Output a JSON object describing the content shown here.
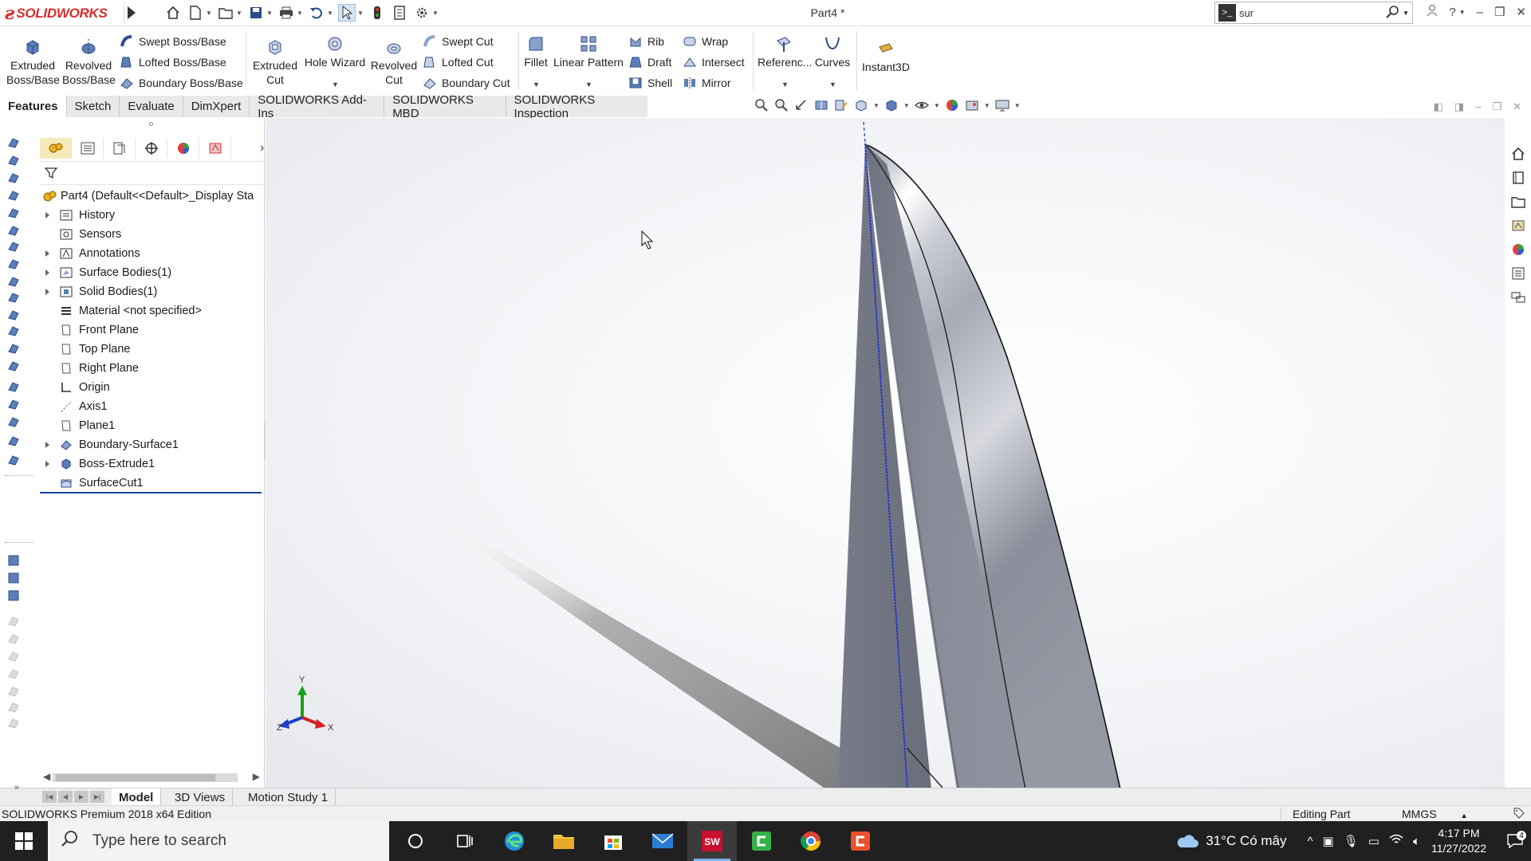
{
  "app": {
    "brand": "SOLIDWORKS",
    "document_title": "Part4 *",
    "search_value": "sur"
  },
  "ribbon": {
    "extruded_boss": [
      "Extruded",
      "Boss/Base"
    ],
    "revolved_boss": [
      "Revolved",
      "Boss/Base"
    ],
    "swept_boss": "Swept Boss/Base",
    "lofted_boss": "Lofted Boss/Base",
    "boundary_boss": "Boundary Boss/Base",
    "extruded_cut": [
      "Extruded",
      "Cut"
    ],
    "hole_wizard": "Hole Wizard",
    "revolved_cut": [
      "Revolved",
      "Cut"
    ],
    "swept_cut": "Swept Cut",
    "lofted_cut": "Lofted Cut",
    "boundary_cut": "Boundary Cut",
    "fillet": "Fillet",
    "linear_pattern": "Linear Pattern",
    "rib": "Rib",
    "draft": "Draft",
    "shell": "Shell",
    "wrap": "Wrap",
    "intersect": "Intersect",
    "mirror": "Mirror",
    "reference": "Referenc...",
    "curves": "Curves",
    "instant3d": "Instant3D"
  },
  "tabs": [
    "Features",
    "Sketch",
    "Evaluate",
    "DimXpert",
    "SOLIDWORKS Add-Ins",
    "SOLIDWORKS MBD",
    "SOLIDWORKS Inspection"
  ],
  "tree": {
    "root": "Part4  (Default<<Default>_Display Sta",
    "items": [
      "History",
      "Sensors",
      "Annotations",
      "Surface Bodies(1)",
      "Solid Bodies(1)",
      "Material <not specified>",
      "Front Plane",
      "Top Plane",
      "Right Plane",
      "Origin",
      "Axis1",
      "Plane1",
      "Boundary-Surface1",
      "Boss-Extrude1",
      "SurfaceCut1"
    ]
  },
  "viewport": {
    "triad": {
      "x": "X",
      "y": "Y",
      "z": "Z"
    },
    "colors": {
      "body_dark": "#6f7380",
      "body_mid": "#8c909c",
      "edge_blue": "#1d2fcf",
      "shadow": "#a5a5a8"
    }
  },
  "bottom_tabs": [
    "Model",
    "3D Views",
    "Motion Study 1"
  ],
  "status": {
    "edition": "SOLIDWORKS Premium 2018 x64 Edition",
    "mode": "Editing Part",
    "units": "MMGS"
  },
  "taskbar": {
    "search_placeholder": "Type here to search",
    "weather": "31°C  Có mây",
    "time": "4:17 PM",
    "date": "11/27/2022",
    "notifications": "4"
  }
}
